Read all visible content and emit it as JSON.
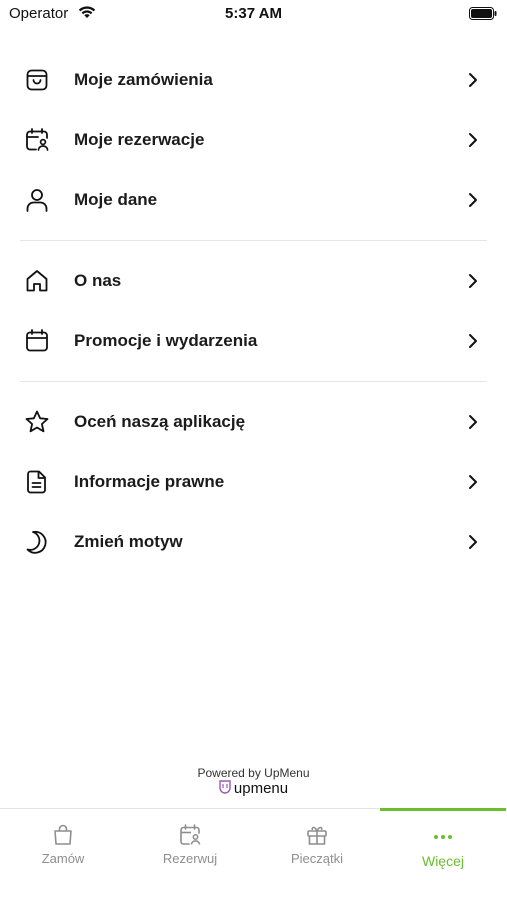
{
  "status_bar": {
    "carrier": "Operator",
    "time": "5:37 AM"
  },
  "menu": {
    "group1": [
      {
        "label": "Moje zamówienia",
        "icon": "shopping-bag-icon"
      },
      {
        "label": "Moje rezerwacje",
        "icon": "calendar-user-icon"
      },
      {
        "label": "Moje dane",
        "icon": "user-icon"
      }
    ],
    "group2": [
      {
        "label": "O nas",
        "icon": "home-icon"
      },
      {
        "label": "Promocje i wydarzenia",
        "icon": "calendar-icon"
      }
    ],
    "group3": [
      {
        "label": "Oceń naszą aplikację",
        "icon": "star-icon"
      },
      {
        "label": "Informacje prawne",
        "icon": "document-icon"
      },
      {
        "label": "Zmień motyw",
        "icon": "moon-icon"
      }
    ]
  },
  "footer": {
    "powered_by": "Powered by UpMenu",
    "brand": "upmenu"
  },
  "tabbar": {
    "tabs": [
      {
        "label": "Zamów",
        "icon": "shopping-bag-icon"
      },
      {
        "label": "Rezerwuj",
        "icon": "calendar-user-icon"
      },
      {
        "label": "Pieczątki",
        "icon": "gift-icon"
      },
      {
        "label": "Więcej",
        "icon": "more-dots-icon"
      }
    ],
    "active_color": "#6abf2e",
    "inactive_color": "#8e8e8e"
  }
}
